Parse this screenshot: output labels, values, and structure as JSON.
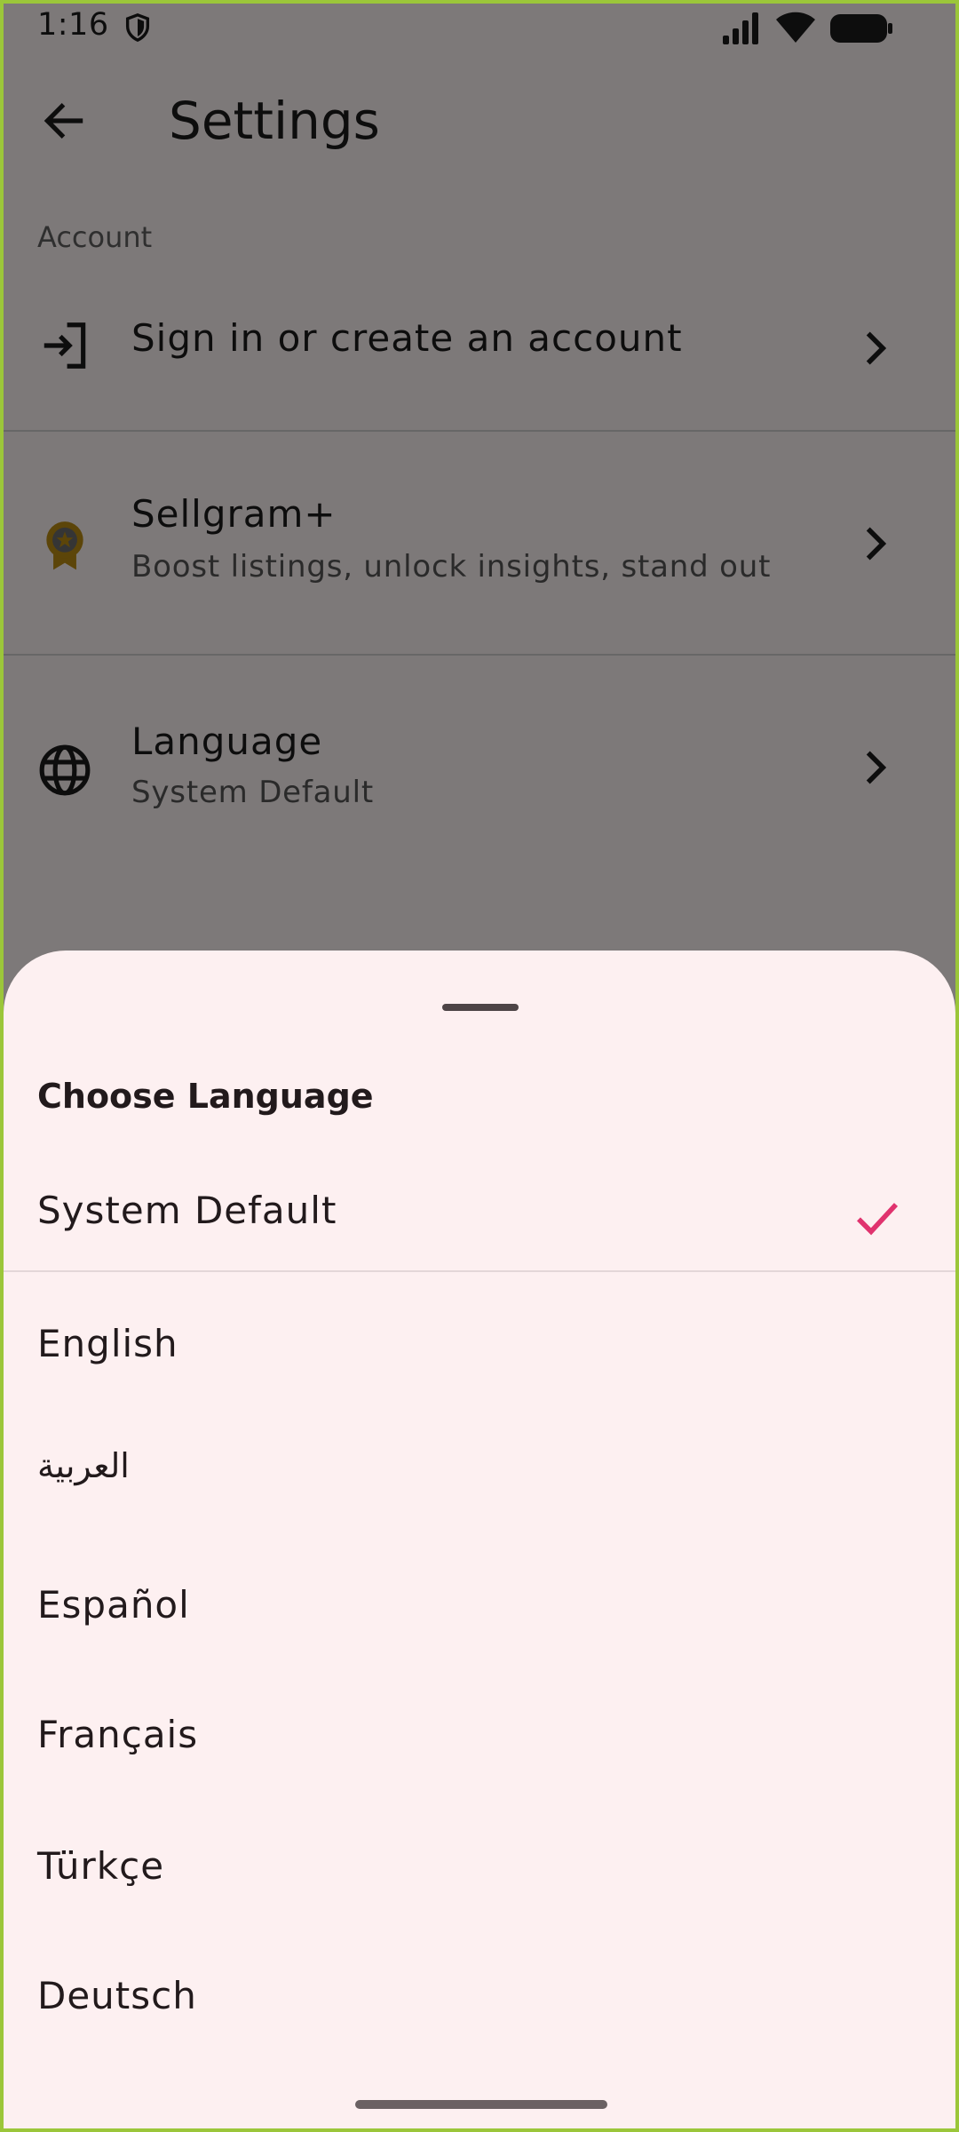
{
  "status_bar": {
    "time": "1:16"
  },
  "app_bar": {
    "title": "Settings"
  },
  "settings": {
    "section_header": "Account",
    "rows": [
      {
        "title": "Sign in or create an account",
        "subtitle": ""
      },
      {
        "title": "Sellgram+",
        "subtitle": "Boost listings, unlock insights, stand out"
      },
      {
        "title": "Language",
        "subtitle": "System Default"
      }
    ]
  },
  "sheet": {
    "title": "Choose Language",
    "options": [
      {
        "label": "System Default",
        "selected": true
      },
      {
        "label": "English",
        "selected": false
      },
      {
        "label": "العربية",
        "selected": false
      },
      {
        "label": "Español",
        "selected": false
      },
      {
        "label": "Français",
        "selected": false
      },
      {
        "label": "Türkçe",
        "selected": false
      },
      {
        "label": "Deutsch",
        "selected": false
      }
    ]
  },
  "colors": {
    "accent": "#e0336e",
    "badge_gold": "#b88a12",
    "sheet_bg": "#fdf0f1",
    "frame": "#9bc63a"
  },
  "icons": {
    "shield": "shield-icon",
    "signal": "signal-icon",
    "wifi": "wifi-icon",
    "battery": "battery-icon",
    "back": "back-arrow-icon",
    "login": "login-icon",
    "badge": "award-badge-icon",
    "globe": "globe-icon",
    "chevron": "chevron-right-icon",
    "check": "check-icon"
  }
}
